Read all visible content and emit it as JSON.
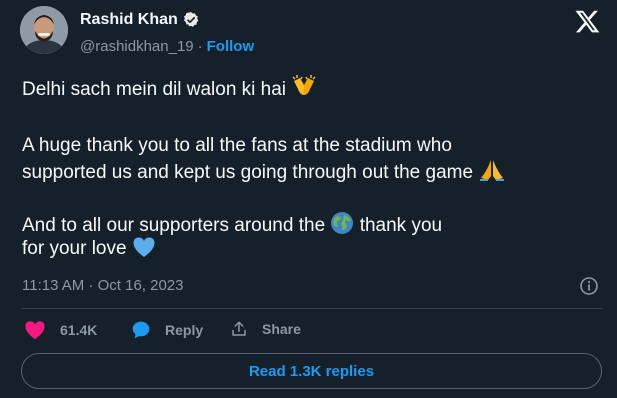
{
  "author": {
    "name": "Rashid Khan",
    "handle": "@rashidkhan_19",
    "separator": "·",
    "follow_label": "Follow"
  },
  "tweet": {
    "line1": "Delhi sach mein dil walon ki hai",
    "line1_emoji": "raising-hands-emoji",
    "line2": "A huge thank you to all the fans at the stadium who",
    "line3": "supported us and kept us going through out the game",
    "line3_emoji": "folded-hands-emoji",
    "line4_a": "And to all our supporters around the",
    "line4_emoji": "globe-emoji",
    "line4_b": "thank you",
    "line5": "for your love",
    "line5_emoji": "blue-heart-emoji"
  },
  "meta": {
    "timestamp": "11:13 AM · Oct 16, 2023"
  },
  "actions": {
    "likes_count": "61.4K",
    "reply_label": "Reply",
    "share_label": "Share",
    "read_replies_label": "Read 1.3K replies"
  },
  "colors": {
    "background": "#15202b",
    "accent": "#1d9bf0",
    "like": "#f91880",
    "muted": "#8b98a5",
    "border": "#38444d"
  }
}
